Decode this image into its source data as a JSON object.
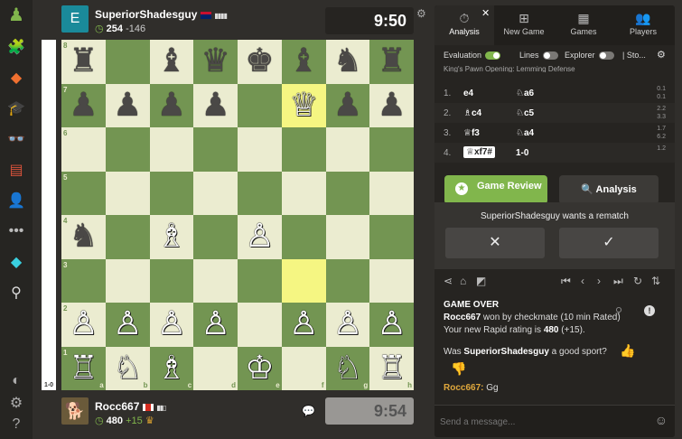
{
  "top_player": {
    "avatar_letter": "E",
    "name": "SuperiorShadesguy",
    "rating": "254",
    "rating_change": "-146",
    "clock": "9:50",
    "bars": "▮▮▮▮"
  },
  "bottom_player": {
    "name": "Rocc667",
    "rating": "480",
    "rating_change": "+15",
    "clock": "9:54",
    "bars": "▮▮▯"
  },
  "eval_label": "1-0",
  "board": {
    "files": [
      "a",
      "b",
      "c",
      "d",
      "e",
      "f",
      "g",
      "h"
    ],
    "ranks": [
      "8",
      "7",
      "6",
      "5",
      "4",
      "3",
      "2",
      "1"
    ],
    "highlights": [
      "f7",
      "f3"
    ],
    "pieces": [
      {
        "sq": "a8",
        "glyph": "♜",
        "color": "b"
      },
      {
        "sq": "c8",
        "glyph": "♝",
        "color": "b"
      },
      {
        "sq": "d8",
        "glyph": "♛",
        "color": "b"
      },
      {
        "sq": "e8",
        "glyph": "♚",
        "color": "b"
      },
      {
        "sq": "f8",
        "glyph": "♝",
        "color": "b"
      },
      {
        "sq": "g8",
        "glyph": "♞",
        "color": "b"
      },
      {
        "sq": "h8",
        "glyph": "♜",
        "color": "b"
      },
      {
        "sq": "a7",
        "glyph": "♟",
        "color": "b"
      },
      {
        "sq": "b7",
        "glyph": "♟",
        "color": "b"
      },
      {
        "sq": "c7",
        "glyph": "♟",
        "color": "b"
      },
      {
        "sq": "d7",
        "glyph": "♟",
        "color": "b"
      },
      {
        "sq": "f7",
        "glyph": "♕",
        "color": "w"
      },
      {
        "sq": "g7",
        "glyph": "♟",
        "color": "b"
      },
      {
        "sq": "h7",
        "glyph": "♟",
        "color": "b"
      },
      {
        "sq": "a4",
        "glyph": "♞",
        "color": "b"
      },
      {
        "sq": "c4",
        "glyph": "♗",
        "color": "w"
      },
      {
        "sq": "e4",
        "glyph": "♙",
        "color": "w"
      },
      {
        "sq": "a2",
        "glyph": "♙",
        "color": "w"
      },
      {
        "sq": "b2",
        "glyph": "♙",
        "color": "w"
      },
      {
        "sq": "c2",
        "glyph": "♙",
        "color": "w"
      },
      {
        "sq": "d2",
        "glyph": "♙",
        "color": "w"
      },
      {
        "sq": "f2",
        "glyph": "♙",
        "color": "w"
      },
      {
        "sq": "g2",
        "glyph": "♙",
        "color": "w"
      },
      {
        "sq": "h2",
        "glyph": "♙",
        "color": "w"
      },
      {
        "sq": "a1",
        "glyph": "♖",
        "color": "w"
      },
      {
        "sq": "b1",
        "glyph": "♘",
        "color": "w"
      },
      {
        "sq": "c1",
        "glyph": "♗",
        "color": "w"
      },
      {
        "sq": "e1",
        "glyph": "♔",
        "color": "w"
      },
      {
        "sq": "g1",
        "glyph": "♘",
        "color": "w"
      },
      {
        "sq": "h1",
        "glyph": "♖",
        "color": "w"
      }
    ]
  },
  "tabs": [
    {
      "label": "Analysis",
      "icon": "⏱"
    },
    {
      "label": "New Game",
      "icon": "⊞"
    },
    {
      "label": "Games",
      "icon": "▦"
    },
    {
      "label": "Players",
      "icon": "👥"
    }
  ],
  "toggles": {
    "evaluation": "Evaluation",
    "lines": "Lines",
    "explorer": "Explorer",
    "stockfish": "Sto..."
  },
  "opening": "King's Pawn Opening: Lemming Defense",
  "moves": [
    {
      "num": "1.",
      "white": "e4",
      "black": "♘a6",
      "wt": "0.1",
      "bt": "0.1"
    },
    {
      "num": "2.",
      "white": "♗c4",
      "black": "♘c5",
      "wt": "2.2",
      "bt": "3.3"
    },
    {
      "num": "3.",
      "white": "♕f3",
      "black": "♘a4",
      "wt": "1.7",
      "bt": "6.2"
    },
    {
      "num": "4.",
      "white": "♕xf7#",
      "black": "1-0",
      "wt": "1.2",
      "bt": ""
    }
  ],
  "buttons": {
    "game_review": "Game Review",
    "analysis": "Analysis"
  },
  "rematch": {
    "text": "SuperiorShadesguy wants a rematch",
    "decline": "✕",
    "accept": "✓"
  },
  "toolbar_icons": [
    "⋖",
    "⌂",
    "◩",
    "⏮",
    "‹",
    "›",
    "⏭",
    "↻",
    "⇅"
  ],
  "chat": {
    "game_over": "GAME OVER",
    "winner": "Rocc667",
    "result_text": " won by checkmate (10 min Rated)",
    "rating_prefix": "Your new Rapid rating is ",
    "new_rating": "480",
    "rating_suffix": " (+15).",
    "sport_prefix": "Was ",
    "sport_name": "SuperiorShadesguy",
    "sport_suffix": " a good sport?",
    "msg_user": "Rocc667:",
    "msg_text": " Gg"
  },
  "message_placeholder": "Send a message...",
  "colors": {
    "light": "#ebecd0",
    "dark": "#739552",
    "highlight": "#f5f682",
    "accent": "#81b64c"
  }
}
